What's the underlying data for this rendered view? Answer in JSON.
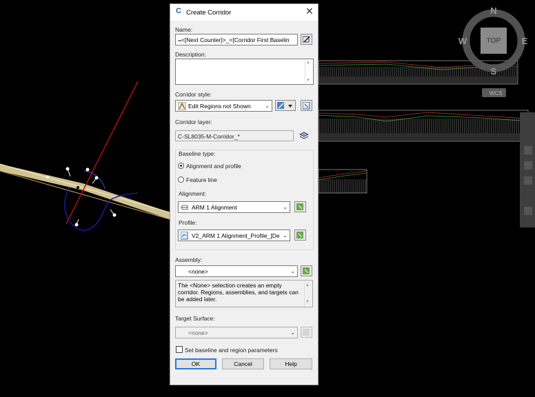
{
  "dialog": {
    "title": "Create Corridor",
    "name_label": "Name:",
    "name_value": "⫬<[Next Counter]>_<[Corridor First Baselin",
    "description_label": "Description:",
    "corridor_style_label": "Corridor style:",
    "corridor_style_value": "Edit Regions not Shown",
    "corridor_layer_label": "Corridor layer:",
    "corridor_layer_value": "C-SL8035-M-Corridor_*",
    "baseline_type_label": "Baseline type:",
    "radio_alignment_profile": "Alignment and profile",
    "radio_feature_line": "Feature line",
    "alignment_label": "Alignment:",
    "alignment_value": "ARM 1 Alignment",
    "profile_label": "Profile:",
    "profile_value": "V2_ARM 1 Alignment_Profile_[De",
    "assembly_label": "Assembly:",
    "assembly_value": "<none>",
    "assembly_info": "The <None> selection creates an empty corridor. Regions, assemblies, and targets can be added later.",
    "target_surface_label": "Target Surface:",
    "target_surface_value": "<none>",
    "checkbox_label": "Set baseline and region parameters",
    "ok_label": "OK",
    "cancel_label": "Cancel",
    "help_label": "Help"
  },
  "viewcube": {
    "north": "N",
    "south": "S",
    "east": "E",
    "west": "W",
    "face": "TOP",
    "wcs": "WCS"
  },
  "colors": {
    "road": "#e8d7a0",
    "alignment": "#b01010",
    "curve": "#1a1aa8",
    "dialog_bg": "#f0f0f0",
    "default_button_border": "#2a7ad2"
  }
}
